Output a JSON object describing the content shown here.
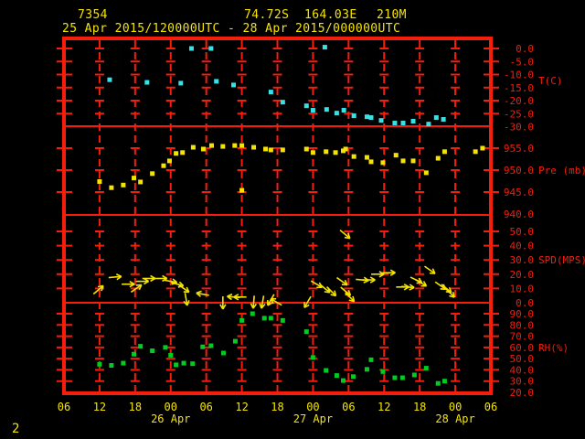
{
  "header": {
    "station_id": "7354",
    "latitude": "74.72S",
    "longitude": "164.03E",
    "elevation": "210M",
    "period": "25 Apr 2015/120000UTC - 28 Apr 2015/000000UTC"
  },
  "page_number": "2",
  "colors": {
    "background": "#000000",
    "frame_red": "#f51d0c",
    "text_yellow": "#f5e400",
    "temperature": "#35e2e6",
    "pressure": "#f5e400",
    "wind": "#f5e400",
    "humidity": "#00cc22"
  },
  "chart_data": {
    "type": "scatter",
    "subtype": "meteogram-time-series",
    "time_axis": {
      "start": "25 Apr 2015 06UTC",
      "end": "28 Apr 2015 06UTC",
      "hours_span": 72,
      "hour_labels": [
        "06",
        "12",
        "18",
        "00",
        "06",
        "12",
        "18",
        "00",
        "06",
        "12",
        "18",
        "00",
        "06"
      ],
      "date_labels": [
        "26 Apr",
        "27 Apr",
        "28 Apr"
      ],
      "grid": "dashed-vertical-with-crossticks"
    },
    "panels": [
      {
        "name": "temperature",
        "unit_label": "T(C)",
        "tick_labels": [
          "0.0",
          "-5.0",
          "-10.0",
          "-15.0",
          "-20.0",
          "-25.0",
          "-30.0"
        ],
        "tick_values": [
          0,
          -5,
          -10,
          -15,
          -20,
          -25,
          -30
        ],
        "ylim": [
          -30,
          0
        ],
        "series": [
          [
            7.7,
            -12.0
          ],
          [
            14.0,
            -13.0
          ],
          [
            19.7,
            -13.3
          ],
          [
            21.5,
            0.0
          ],
          [
            24.8,
            0.0
          ],
          [
            25.7,
            -12.6
          ],
          [
            28.6,
            -14.0
          ],
          [
            34.9,
            -16.7
          ],
          [
            36.9,
            -20.6
          ],
          [
            40.9,
            -22.0
          ],
          [
            42.0,
            -23.7
          ],
          [
            44.0,
            0.5
          ],
          [
            44.3,
            -23.4
          ],
          [
            46.0,
            -24.8
          ],
          [
            47.2,
            -23.7
          ],
          [
            48.9,
            -25.8
          ],
          [
            51.1,
            -26.2
          ],
          [
            51.8,
            -26.5
          ],
          [
            53.5,
            -27.6
          ],
          [
            55.8,
            -28.6
          ],
          [
            57.2,
            -28.6
          ],
          [
            58.9,
            -27.9
          ],
          [
            61.5,
            -29.0
          ],
          [
            62.8,
            -26.5
          ],
          [
            64.0,
            -27.2
          ]
        ]
      },
      {
        "name": "pressure",
        "unit_label": "Pre (mb)",
        "tick_labels": [
          "955.0",
          "950.0",
          "945.0",
          "940.0"
        ],
        "tick_values": [
          955,
          950,
          945,
          940
        ],
        "ylim": [
          940,
          955
        ],
        "series": [
          [
            6.0,
            947.4
          ],
          [
            8.0,
            946.0
          ],
          [
            10.0,
            946.6
          ],
          [
            11.8,
            948.2
          ],
          [
            12.9,
            947.3
          ],
          [
            14.9,
            949.2
          ],
          [
            16.8,
            951.0
          ],
          [
            17.8,
            952.1
          ],
          [
            18.9,
            953.8
          ],
          [
            20.0,
            954.0
          ],
          [
            21.8,
            955.2
          ],
          [
            23.5,
            954.8
          ],
          [
            24.9,
            955.6
          ],
          [
            26.8,
            955.4
          ],
          [
            28.8,
            955.6
          ],
          [
            30.0,
            955.6
          ],
          [
            30.0,
            945.4
          ],
          [
            32.0,
            955.2
          ],
          [
            34.0,
            954.8
          ],
          [
            34.9,
            954.6
          ],
          [
            36.9,
            954.6
          ],
          [
            40.9,
            954.8
          ],
          [
            42.0,
            954.0
          ],
          [
            44.2,
            954.2
          ],
          [
            45.8,
            954.0
          ],
          [
            47.1,
            954.4
          ],
          [
            47.5,
            954.8
          ],
          [
            48.9,
            953.1
          ],
          [
            51.1,
            952.9
          ],
          [
            51.8,
            951.9
          ],
          [
            53.8,
            951.7
          ],
          [
            56.0,
            953.4
          ],
          [
            57.2,
            952.1
          ],
          [
            58.9,
            952.1
          ],
          [
            61.1,
            949.4
          ],
          [
            63.1,
            952.7
          ],
          [
            64.2,
            954.2
          ],
          [
            69.4,
            954.2
          ],
          [
            70.6,
            955.0
          ]
        ]
      },
      {
        "name": "wind",
        "unit_label": "SPD(MPS)",
        "tick_labels": [
          "50.0",
          "40.0",
          "30.0",
          "20.0",
          "10.0",
          "0.0"
        ],
        "tick_values": [
          50,
          40,
          30,
          20,
          10,
          0
        ],
        "ylim": [
          0,
          50
        ],
        "arrow_note": "arrows [hours_from_start, speed_mps, screen_direction_deg] 0=east 90=down",
        "arrows": [
          [
            5.8,
            9,
            -40
          ],
          [
            8.6,
            18,
            -5
          ],
          [
            10.8,
            13,
            0
          ],
          [
            12.2,
            10,
            -35
          ],
          [
            13.2,
            15,
            0
          ],
          [
            14.3,
            17,
            0
          ],
          [
            16.3,
            17,
            0
          ],
          [
            18.0,
            15,
            10
          ],
          [
            19.1,
            13,
            15
          ],
          [
            20.2,
            10,
            35
          ],
          [
            20.6,
            2.5,
            80
          ],
          [
            23.4,
            6,
            190
          ],
          [
            26.8,
            0,
            90
          ],
          [
            28.6,
            4,
            185
          ],
          [
            29.7,
            4,
            180
          ],
          [
            32.0,
            0.5,
            95
          ],
          [
            33.5,
            0.5,
            100
          ],
          [
            34.9,
            2,
            120
          ],
          [
            35.8,
            0.5,
            210
          ],
          [
            41.1,
            0.5,
            120
          ],
          [
            42.6,
            13,
            30
          ],
          [
            44.0,
            10,
            40
          ],
          [
            45.1,
            8,
            45
          ],
          [
            46.9,
            15,
            35
          ],
          [
            47.4,
            48,
            40
          ],
          [
            47.5,
            8,
            40
          ],
          [
            48.2,
            4,
            45
          ],
          [
            50.3,
            16,
            5
          ],
          [
            51.4,
            16,
            0
          ],
          [
            52.9,
            20,
            0
          ],
          [
            54.8,
            21,
            0
          ],
          [
            57.1,
            11,
            0
          ],
          [
            58.0,
            11,
            5
          ],
          [
            59.4,
            16,
            25
          ],
          [
            60.2,
            14,
            30
          ],
          [
            61.7,
            23,
            35
          ],
          [
            63.5,
            12,
            35
          ],
          [
            64.5,
            10,
            40
          ],
          [
            65.1,
            7,
            45
          ]
        ]
      },
      {
        "name": "humidity",
        "unit_label": "RH(%)",
        "tick_labels": [
          "90.0",
          "80.0",
          "70.0",
          "60.0",
          "50.0",
          "40.0",
          "30.0",
          "20.0"
        ],
        "tick_values": [
          90,
          80,
          70,
          60,
          50,
          40,
          30,
          20
        ],
        "ylim": [
          20,
          90
        ],
        "series": [
          [
            6.0,
            45
          ],
          [
            8.0,
            44
          ],
          [
            10.0,
            46
          ],
          [
            11.8,
            54
          ],
          [
            12.9,
            61
          ],
          [
            14.9,
            57
          ],
          [
            17.1,
            60
          ],
          [
            18.0,
            53
          ],
          [
            18.9,
            44.5
          ],
          [
            20.2,
            46
          ],
          [
            21.7,
            45.5
          ],
          [
            23.4,
            60.5
          ],
          [
            24.8,
            61.5
          ],
          [
            26.9,
            55
          ],
          [
            28.9,
            65.5
          ],
          [
            30.0,
            84
          ],
          [
            31.8,
            90
          ],
          [
            33.8,
            86
          ],
          [
            34.9,
            86
          ],
          [
            36.9,
            84
          ],
          [
            40.9,
            74
          ],
          [
            42.0,
            51
          ],
          [
            44.2,
            39.5
          ],
          [
            46.0,
            35
          ],
          [
            47.1,
            30.5
          ],
          [
            48.8,
            34
          ],
          [
            51.1,
            40.5
          ],
          [
            51.8,
            49
          ],
          [
            53.8,
            38.5
          ],
          [
            55.8,
            33
          ],
          [
            57.1,
            33
          ],
          [
            59.1,
            35.5
          ],
          [
            61.1,
            41.5
          ],
          [
            63.1,
            28
          ],
          [
            64.2,
            30
          ]
        ]
      }
    ]
  }
}
